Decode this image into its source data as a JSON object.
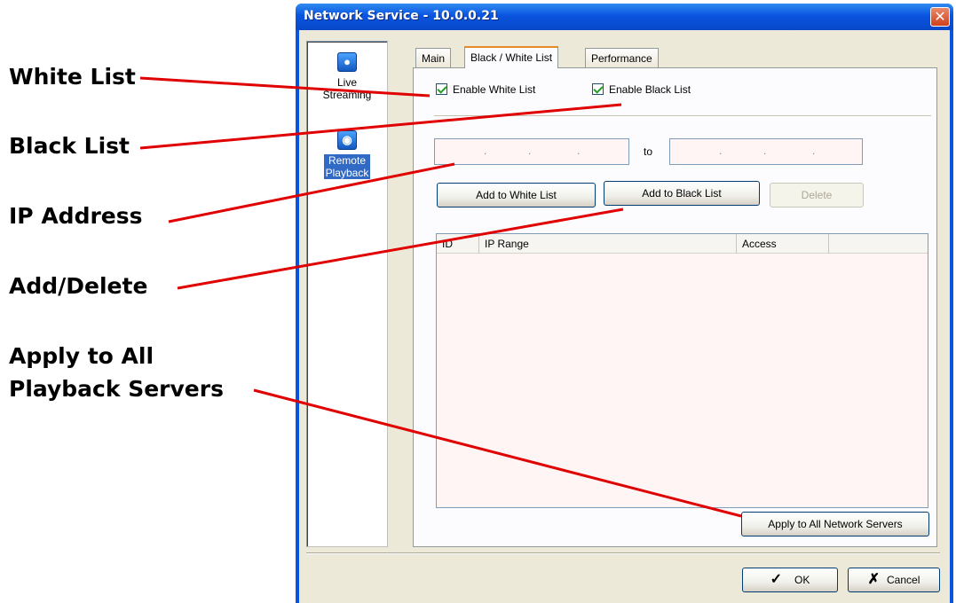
{
  "callouts": {
    "white_list": "White List",
    "black_list": "Black List",
    "ip_address": "IP Address",
    "add_delete": "Add/Delete",
    "apply_line1": "Apply to All",
    "apply_line2": "Playback Servers"
  },
  "window": {
    "title": "Network Service - 10.0.0.21",
    "close_glyph": "✕"
  },
  "sidebar": {
    "items": [
      {
        "label_line1": "Live",
        "label_line2": "Streaming",
        "icon": "live-streaming-icon"
      },
      {
        "label_line1": "Remote",
        "label_line2": "Playback",
        "icon": "remote-playback-icon",
        "selected": true
      }
    ]
  },
  "tabs": [
    {
      "label": "Main"
    },
    {
      "label": "Black / White List",
      "active": true
    },
    {
      "label": "Performance"
    }
  ],
  "options": {
    "enable_white_list": "Enable White List",
    "enable_black_list": "Enable Black List"
  },
  "ip_range": {
    "to_label": "to",
    "dot": "."
  },
  "buttons": {
    "add_white": "Add to White List",
    "add_black": "Add to Black List",
    "delete": "Delete",
    "apply_all": "Apply to All Network Servers",
    "ok": "OK",
    "cancel": "Cancel"
  },
  "list": {
    "columns": [
      "ID",
      "IP Range",
      "Access"
    ]
  },
  "colors": {
    "title_bar": "#0a54e0",
    "callout_line": "#e00000",
    "dialog_face": "#ece9d8"
  }
}
